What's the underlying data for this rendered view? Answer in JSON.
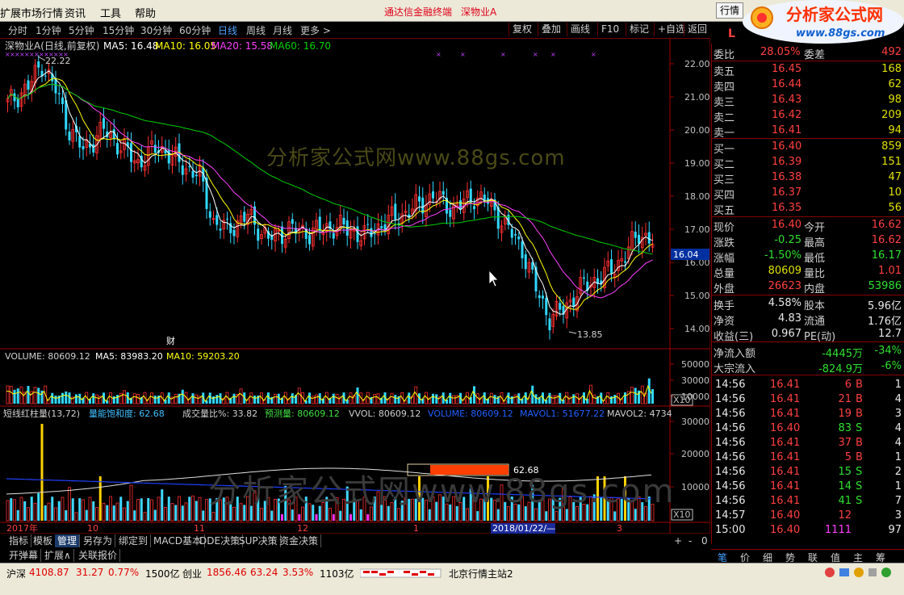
{
  "menu": {
    "items": [
      "扩展市场行情",
      "资讯",
      "工具",
      "帮助"
    ],
    "title_app": "通达信金融终端",
    "title_stock": "深物业A",
    "hq_button": "行情",
    "logo_text": "分析家公式网",
    "logo_url": "www.88gs.com"
  },
  "toolbar": {
    "periods": [
      "分时",
      "1分钟",
      "5分钟",
      "15分钟",
      "30分钟",
      "60分钟",
      "日线",
      "周线",
      "月线",
      "更多 >"
    ],
    "active_period": "日线",
    "right_buttons": [
      "复权",
      "叠加",
      "画线",
      "F10",
      "标记",
      "+自选",
      "返回"
    ]
  },
  "main_chart": {
    "header_name": "深物业A(日线,前复权)",
    "ma5": "MA5: 16.48",
    "ma10": "MA10: 16.05",
    "ma20": "MA20: 15.58",
    "ma60": "MA60: 16.70",
    "high_label": "22.22",
    "low_label": "13.85",
    "cursor_price": "16.04",
    "fin_marker": "财",
    "watermark": "分析家公式网www.88gs.com",
    "y_ticks": [
      "22.00",
      "21.00",
      "20.00",
      "19.00",
      "18.00",
      "17.00",
      "16.00",
      "15.00",
      "14.00"
    ],
    "colors": {
      "up": "#ff3030",
      "down": "#30d8ff",
      "ma5": "#ffffff",
      "ma10": "#ffff00",
      "ma20": "#ff40ff",
      "ma60": "#00d000"
    }
  },
  "volume_panel": {
    "header": "VOLUME: 80609.12",
    "ma5": "MA5: 83983.20",
    "ma10": "MA10: 59203.20",
    "y_ticks": [
      "50000",
      "30000",
      "10000"
    ],
    "scale": "X10"
  },
  "indicator_panel": {
    "name": "短线红柱量(13,72)",
    "f1": "量能饱和度: 62.68",
    "f2": "成交量比%: 33.82",
    "f3": "预测量: 80609.12",
    "f4": "VVOL: 80609.12",
    "f5": "VOLUME: 80609.12",
    "f6": "MAVOL1: 51677.22",
    "f7": "MAVOL2: 4734",
    "y_ticks": [
      "30000",
      "20000",
      "10000"
    ],
    "scale": "X10",
    "box_label": "62.68",
    "watermark": "分析家公式网www.88gs.com"
  },
  "x_axis": {
    "labels": [
      "2017年",
      "10",
      "11",
      "12",
      "1",
      "3"
    ],
    "cursor_date": "2018/01/22/—"
  },
  "bottom_tabs": {
    "row1": [
      "指标",
      "模板",
      "管理",
      "另存为",
      "绑定到",
      "MACD基本",
      "DDE决策",
      "SUP决策",
      "资金决策"
    ],
    "active": "管理",
    "row2": [
      "开弹幕",
      "扩展∧",
      "关联报价"
    ],
    "nav": [
      "+",
      "-",
      "0"
    ]
  },
  "quote": {
    "wb_label": "委比",
    "wb": "28.05%",
    "wc_label": "委差",
    "wc": "492",
    "sells": [
      {
        "label": "卖五",
        "price": "16.45",
        "vol": "168"
      },
      {
        "label": "卖四",
        "price": "16.44",
        "vol": "62"
      },
      {
        "label": "卖三",
        "price": "16.43",
        "vol": "98"
      },
      {
        "label": "卖二",
        "price": "16.42",
        "vol": "209"
      },
      {
        "label": "卖一",
        "price": "16.41",
        "vol": "94"
      }
    ],
    "buys": [
      {
        "label": "买一",
        "price": "16.40",
        "vol": "859"
      },
      {
        "label": "买二",
        "price": "16.39",
        "vol": "151"
      },
      {
        "label": "买三",
        "price": "16.38",
        "vol": "47"
      },
      {
        "label": "买四",
        "price": "16.37",
        "vol": "10"
      },
      {
        "label": "买五",
        "price": "16.35",
        "vol": "56"
      }
    ],
    "stats": [
      {
        "l1": "现价",
        "v1": "16.40",
        "c1": "up",
        "l2": "今开",
        "v2": "16.62",
        "c2": "up"
      },
      {
        "l1": "涨跌",
        "v1": "-0.25",
        "c1": "dn",
        "l2": "最高",
        "v2": "16.62",
        "c2": "up"
      },
      {
        "l1": "涨幅",
        "v1": "-1.50%",
        "c1": "dn",
        "l2": "最低",
        "v2": "16.17",
        "c2": "dn"
      },
      {
        "l1": "总量",
        "v1": "80609",
        "c1": "yel",
        "l2": "量比",
        "v2": "1.01",
        "c2": "up"
      },
      {
        "l1": "外盘",
        "v1": "26623",
        "c1": "up",
        "l2": "内盘",
        "v2": "53986",
        "c2": "dn"
      }
    ],
    "finance": [
      {
        "l1": "换手",
        "v1": "4.58%",
        "l2": "股本",
        "v2": "5.96亿"
      },
      {
        "l1": "净资",
        "v1": "4.83",
        "l2": "流通",
        "v2": "1.76亿"
      },
      {
        "l1": "收益(三)",
        "v1": "0.967",
        "l2": "PE(动)",
        "v2": "12.7"
      }
    ],
    "flow": [
      {
        "label": "净流入额",
        "value": "-4445万",
        "pct": "-34%"
      },
      {
        "label": "大宗流入",
        "value": "-824.9万",
        "pct": "-6%"
      }
    ],
    "ticks": [
      {
        "t": "14:56",
        "p": "16.41",
        "v": "6",
        "bs": "B",
        "n": "1"
      },
      {
        "t": "14:56",
        "p": "16.41",
        "v": "21",
        "bs": "B",
        "n": "4"
      },
      {
        "t": "14:56",
        "p": "16.41",
        "v": "19",
        "bs": "B",
        "n": "3"
      },
      {
        "t": "14:56",
        "p": "16.40",
        "v": "83",
        "bs": "S",
        "n": "4"
      },
      {
        "t": "14:56",
        "p": "16.41",
        "v": "37",
        "bs": "B",
        "n": "4"
      },
      {
        "t": "14:56",
        "p": "16.41",
        "v": "5",
        "bs": "B",
        "n": "1"
      },
      {
        "t": "14:56",
        "p": "16.41",
        "v": "15",
        "bs": "S",
        "n": "2"
      },
      {
        "t": "14:56",
        "p": "16.41",
        "v": "14",
        "bs": "S",
        "n": "1"
      },
      {
        "t": "14:56",
        "p": "16.41",
        "v": "41",
        "bs": "S",
        "n": "7"
      },
      {
        "t": "14:57",
        "p": "16.40",
        "v": "12",
        "bs": "",
        "n": "3"
      },
      {
        "t": "15:00",
        "p": "16.40",
        "v": "1111",
        "bs": "",
        "n": "97"
      }
    ],
    "tabs": [
      "笔",
      "价",
      "细",
      "势",
      "联",
      "值",
      "主",
      "筹"
    ],
    "active_tab": "笔",
    "side_marker": "L"
  },
  "status": {
    "sh_label": "沪深",
    "sh_val": "4108.87",
    "sh_chg": "31.27",
    "sh_pct": "0.77%",
    "sh_amt": "1500亿",
    "cy_label": "创业",
    "cy_val": "1856.46",
    "cy_chg": "63.24",
    "cy_pct": "3.53%",
    "cy_amt": "1103亿",
    "server": "北京行情主站2"
  }
}
